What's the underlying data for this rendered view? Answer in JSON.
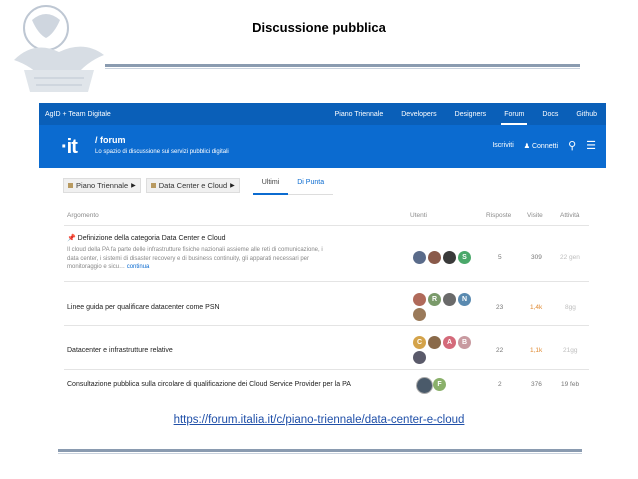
{
  "slide": {
    "title": "Discussione pubblica",
    "url": "https://forum.italia.it/c/piano-triennale/data-center-e-cloud"
  },
  "topnav": {
    "brand": "AgID + Team Digitale",
    "items": [
      "Piano Triennale",
      "Developers",
      "Designers",
      "Forum",
      "Docs",
      "Github"
    ],
    "active": "Forum"
  },
  "header": {
    "logo": "·it",
    "title": "/ forum",
    "subtitle": "Lo spazio di discussione sui servizi pubblici digitali",
    "signup": "Iscriviti",
    "login": "Connetti",
    "icons": [
      "user-icon",
      "search-icon",
      "menu-icon"
    ]
  },
  "filters": {
    "category": "Piano Triennale",
    "subcategory": "Data Center e Cloud",
    "tabs": [
      "Ultimi",
      "Di Punta"
    ]
  },
  "table": {
    "columns": [
      "Argomento",
      "Utenti",
      "Risposte",
      "Visite",
      "Attività"
    ],
    "rows": [
      {
        "title": "Definizione della categoria Data Center e Cloud",
        "pinned": true,
        "desc1": "Il cloud della PA fa parte delle infrastrutture fisiche nazionali assieme alle reti di comunicazione, i",
        "desc2": "data center, i sistemi di disaster recovery e di business continuity, gli apparati necessari per",
        "desc3": "monitoraggio e sicu…",
        "more": "continua",
        "avatars": [
          {
            "letter": "",
            "color": "#5a6b8a"
          },
          {
            "letter": "",
            "color": "#8a5a4a"
          },
          {
            "letter": "",
            "color": "#3a3a3a"
          },
          {
            "letter": "S",
            "color": "#4aa86a"
          }
        ],
        "replies": "5",
        "views": "309",
        "activity": "22 gen"
      },
      {
        "title": "Linee guida per qualificare datacenter come PSN",
        "avatars": [
          {
            "letter": "",
            "color": "#b06a5a"
          },
          {
            "letter": "R",
            "color": "#7a9a6a"
          },
          {
            "letter": "",
            "color": "#6a6a6a"
          },
          {
            "letter": "N",
            "color": "#5a8ab0"
          },
          {
            "letter": "",
            "color": "#9a7a5a"
          }
        ],
        "replies": "23",
        "views": "1,4k",
        "activity": "8gg"
      },
      {
        "title": "Datacenter e infrastrutture relative",
        "avatars": [
          {
            "letter": "C",
            "color": "#d4a34a"
          },
          {
            "letter": "",
            "color": "#8a6a4a"
          },
          {
            "letter": "A",
            "color": "#d46a7a"
          },
          {
            "letter": "B",
            "color": "#c89aa0"
          },
          {
            "letter": "",
            "color": "#5a5a6a"
          }
        ],
        "replies": "22",
        "views": "1,1k",
        "activity": "21gg"
      },
      {
        "title": "Consultazione pubblica sulla circolare di qualificazione dei Cloud Service Provider per la PA",
        "avatars": [
          {
            "letter": "",
            "color": "#4a5a6a"
          },
          {
            "letter": "F",
            "color": "#8ab06a"
          }
        ],
        "replies": "2",
        "views": "376",
        "activity": "19 feb"
      }
    ]
  }
}
